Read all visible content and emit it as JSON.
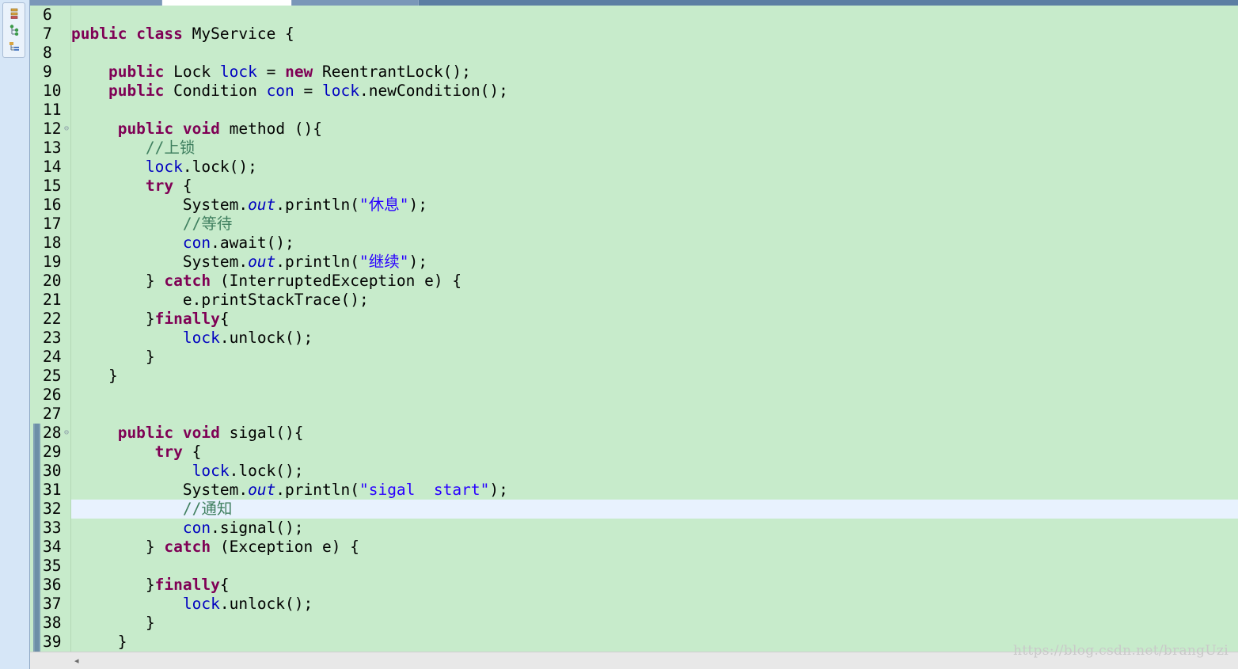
{
  "side_icons": [
    "hierarchy-icon",
    "type-tree-icon",
    "outline-icon"
  ],
  "editor": {
    "current_line": 32,
    "lines": [
      {
        "n": "6",
        "tokens": []
      },
      {
        "n": "7",
        "tokens": [
          {
            "t": "kw",
            "v": "public"
          },
          {
            "t": "p",
            "v": " "
          },
          {
            "t": "kw",
            "v": "class"
          },
          {
            "t": "p",
            "v": " MyService {"
          }
        ]
      },
      {
        "n": "8",
        "tokens": []
      },
      {
        "n": "9",
        "tokens": [
          {
            "t": "p",
            "v": "    "
          },
          {
            "t": "kw",
            "v": "public"
          },
          {
            "t": "p",
            "v": " Lock "
          },
          {
            "t": "fld",
            "v": "lock"
          },
          {
            "t": "p",
            "v": " = "
          },
          {
            "t": "kw",
            "v": "new"
          },
          {
            "t": "p",
            "v": " ReentrantLock();"
          }
        ]
      },
      {
        "n": "10",
        "tokens": [
          {
            "t": "p",
            "v": "    "
          },
          {
            "t": "kw",
            "v": "public"
          },
          {
            "t": "p",
            "v": " Condition "
          },
          {
            "t": "fld",
            "v": "con"
          },
          {
            "t": "p",
            "v": " = "
          },
          {
            "t": "fld",
            "v": "lock"
          },
          {
            "t": "p",
            "v": ".newCondition();"
          }
        ]
      },
      {
        "n": "11",
        "tokens": []
      },
      {
        "n": "12",
        "fold": true,
        "tokens": [
          {
            "t": "p",
            "v": "     "
          },
          {
            "t": "kw",
            "v": "public"
          },
          {
            "t": "p",
            "v": " "
          },
          {
            "t": "kw",
            "v": "void"
          },
          {
            "t": "p",
            "v": " method (){"
          }
        ]
      },
      {
        "n": "13",
        "tokens": [
          {
            "t": "p",
            "v": "        "
          },
          {
            "t": "cmt",
            "v": "//上锁"
          }
        ]
      },
      {
        "n": "14",
        "tokens": [
          {
            "t": "p",
            "v": "        "
          },
          {
            "t": "fld",
            "v": "lock"
          },
          {
            "t": "p",
            "v": ".lock();"
          }
        ]
      },
      {
        "n": "15",
        "tokens": [
          {
            "t": "p",
            "v": "        "
          },
          {
            "t": "kw",
            "v": "try"
          },
          {
            "t": "p",
            "v": " {"
          }
        ]
      },
      {
        "n": "16",
        "tokens": [
          {
            "t": "p",
            "v": "            System."
          },
          {
            "t": "sfld",
            "v": "out"
          },
          {
            "t": "p",
            "v": ".println("
          },
          {
            "t": "str",
            "v": "\"休息\""
          },
          {
            "t": "p",
            "v": ");"
          }
        ]
      },
      {
        "n": "17",
        "tokens": [
          {
            "t": "p",
            "v": "            "
          },
          {
            "t": "cmt",
            "v": "//等待"
          }
        ]
      },
      {
        "n": "18",
        "tokens": [
          {
            "t": "p",
            "v": "            "
          },
          {
            "t": "fld",
            "v": "con"
          },
          {
            "t": "p",
            "v": ".await();"
          }
        ]
      },
      {
        "n": "19",
        "tokens": [
          {
            "t": "p",
            "v": "            System."
          },
          {
            "t": "sfld",
            "v": "out"
          },
          {
            "t": "p",
            "v": ".println("
          },
          {
            "t": "str",
            "v": "\"继续\""
          },
          {
            "t": "p",
            "v": ");"
          }
        ]
      },
      {
        "n": "20",
        "tokens": [
          {
            "t": "p",
            "v": "        } "
          },
          {
            "t": "kw",
            "v": "catch"
          },
          {
            "t": "p",
            "v": " (InterruptedException e) {"
          }
        ]
      },
      {
        "n": "21",
        "tokens": [
          {
            "t": "p",
            "v": "            e.printStackTrace();"
          }
        ]
      },
      {
        "n": "22",
        "tokens": [
          {
            "t": "p",
            "v": "        }"
          },
          {
            "t": "kw",
            "v": "finally"
          },
          {
            "t": "p",
            "v": "{"
          }
        ]
      },
      {
        "n": "23",
        "tokens": [
          {
            "t": "p",
            "v": "            "
          },
          {
            "t": "fld",
            "v": "lock"
          },
          {
            "t": "p",
            "v": ".unlock();"
          }
        ]
      },
      {
        "n": "24",
        "tokens": [
          {
            "t": "p",
            "v": "        }"
          }
        ]
      },
      {
        "n": "25",
        "tokens": [
          {
            "t": "p",
            "v": "    }"
          }
        ]
      },
      {
        "n": "26",
        "tokens": []
      },
      {
        "n": "27",
        "tokens": []
      },
      {
        "n": "28",
        "fold": true,
        "tokens": [
          {
            "t": "p",
            "v": "     "
          },
          {
            "t": "kw",
            "v": "public"
          },
          {
            "t": "p",
            "v": " "
          },
          {
            "t": "kw",
            "v": "void"
          },
          {
            "t": "p",
            "v": " sigal(){"
          }
        ]
      },
      {
        "n": "29",
        "tokens": [
          {
            "t": "p",
            "v": "         "
          },
          {
            "t": "kw",
            "v": "try"
          },
          {
            "t": "p",
            "v": " {"
          }
        ]
      },
      {
        "n": "30",
        "tokens": [
          {
            "t": "p",
            "v": "             "
          },
          {
            "t": "fld",
            "v": "lock"
          },
          {
            "t": "p",
            "v": ".lock();"
          }
        ]
      },
      {
        "n": "31",
        "tokens": [
          {
            "t": "p",
            "v": "            System."
          },
          {
            "t": "sfld",
            "v": "out"
          },
          {
            "t": "p",
            "v": ".println("
          },
          {
            "t": "str",
            "v": "\"sigal  start\""
          },
          {
            "t": "p",
            "v": ");"
          }
        ]
      },
      {
        "n": "32",
        "tokens": [
          {
            "t": "p",
            "v": "            "
          },
          {
            "t": "cmt",
            "v": "//通知"
          }
        ]
      },
      {
        "n": "33",
        "tokens": [
          {
            "t": "p",
            "v": "            "
          },
          {
            "t": "fld",
            "v": "con"
          },
          {
            "t": "p",
            "v": ".signal();"
          }
        ]
      },
      {
        "n": "34",
        "tokens": [
          {
            "t": "p",
            "v": "        } "
          },
          {
            "t": "kw",
            "v": "catch"
          },
          {
            "t": "p",
            "v": " (Exception e) {"
          }
        ]
      },
      {
        "n": "35",
        "tokens": []
      },
      {
        "n": "36",
        "tokens": [
          {
            "t": "p",
            "v": "        }"
          },
          {
            "t": "kw",
            "v": "finally"
          },
          {
            "t": "p",
            "v": "{"
          }
        ]
      },
      {
        "n": "37",
        "tokens": [
          {
            "t": "p",
            "v": "            "
          },
          {
            "t": "fld",
            "v": "lock"
          },
          {
            "t": "p",
            "v": ".unlock();"
          }
        ]
      },
      {
        "n": "38",
        "tokens": [
          {
            "t": "p",
            "v": "        }"
          }
        ]
      },
      {
        "n": "39",
        "tokens": [
          {
            "t": "p",
            "v": "     }"
          }
        ]
      }
    ]
  },
  "scrollbar": {
    "left_arrow": "◂"
  },
  "watermark": "https://blog.csdn.net/brangUzi"
}
